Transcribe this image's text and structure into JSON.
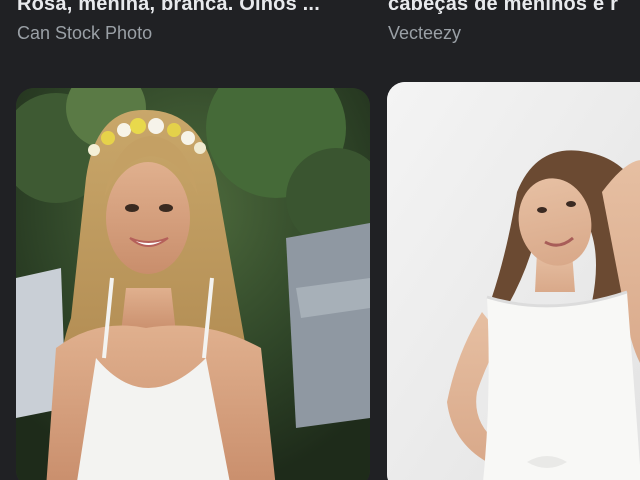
{
  "results": [
    {
      "title": "Rosa, menina, branca. Olhos ...",
      "source": "Can Stock Photo"
    },
    {
      "title": "cabeças de meninos e r",
      "source": "Vecteezy"
    }
  ]
}
